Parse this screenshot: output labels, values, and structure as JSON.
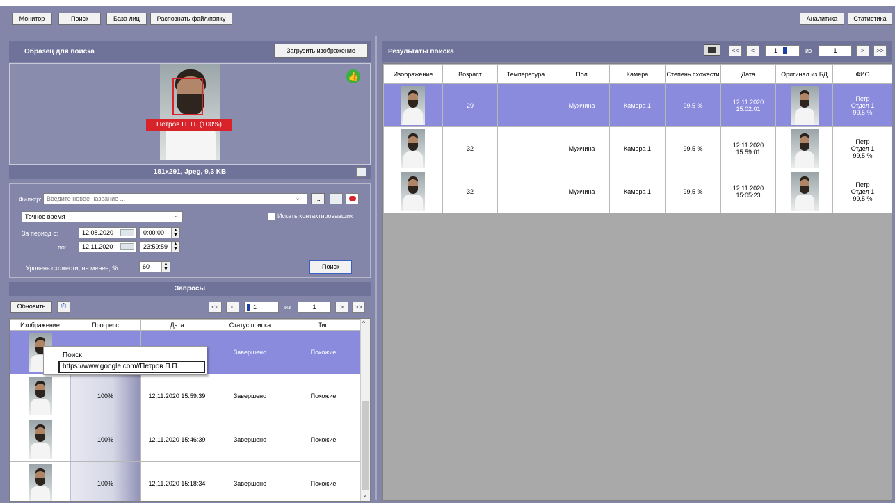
{
  "colors": {
    "panel_bg": "#8386a8",
    "header_bg": "#6f7399",
    "selected_row": "#8a8bdd",
    "results_bg": "#a9a9a9",
    "like_icon": "#3bb03b",
    "face_box": "#d9232a"
  },
  "toolbar": {
    "left": [
      "Монитор",
      "Поиск",
      "База лиц",
      "Распознать файл/папку"
    ],
    "right": [
      "Аналитика",
      "Статистика"
    ]
  },
  "sample": {
    "title": "Образец для поиска",
    "upload_label": "Загрузить изображение",
    "face_label": "Петров П. П. (100%)",
    "image_info": "181x291, Jpeg, 9,3 KB"
  },
  "filter": {
    "label": "Фильтр:",
    "placeholder": "Введите новое название ...",
    "more": "...",
    "time_mode": "Точное время",
    "contacts_label": "Искать контактировавших",
    "period_from_label": "За период с:",
    "period_to_label": "по:",
    "from_date": "12.08.2020",
    "from_time": "0:00:00",
    "to_date": "12.11.2020",
    "to_time": "23:59:59",
    "similarity_label": "Уровень схожести, не менее, %:",
    "similarity_value": "60",
    "search_button": "Поиск"
  },
  "requests": {
    "title": "Запросы",
    "refresh": "Обновить",
    "page": "1",
    "of_label": "из",
    "total": "1",
    "nav": {
      "first": "<<",
      "prev": "<",
      "next": ">",
      "last": ">>"
    },
    "columns": [
      "Изображение",
      "Прогресс",
      "Дата",
      "Статус поиска",
      "Тип"
    ],
    "rows": [
      {
        "progress": "",
        "date": "",
        "status": "Завершено",
        "type": "Похожие",
        "selected": true
      },
      {
        "progress": "100%",
        "date": "12.11.2020 15:59:39",
        "status": "Завершено",
        "type": "Похожие",
        "selected": false
      },
      {
        "progress": "100%",
        "date": "12.11.2020 15:46:39",
        "status": "Завершено",
        "type": "Похожие",
        "selected": false
      },
      {
        "progress": "100%",
        "date": "12.11.2020 15:18:34",
        "status": "Завершено",
        "type": "Похожие",
        "selected": false
      }
    ],
    "context_menu": {
      "item1": "Поиск",
      "item2": "https://www.google.com//Петров П.П."
    }
  },
  "results": {
    "title": "Результаты поиска",
    "page": "1",
    "of_label": "из",
    "total": "1",
    "nav": {
      "first": "<<",
      "prev": "<",
      "next": ">",
      "last": ">>"
    },
    "columns": [
      "Изображение",
      "Возраст",
      "Температура",
      "Пол",
      "Камера",
      "Степень схожести",
      "Дата",
      "Оригинал из БД",
      "ФИО"
    ],
    "rows": [
      {
        "age": "29",
        "temperature": "",
        "gender": "Мужчина",
        "camera": "Камера 1",
        "similarity": "99,5 %",
        "date": "12.11.2020",
        "time": "15:02:01",
        "name": "Петр",
        "dept": "Отдел 1",
        "score": "99,5 %",
        "selected": true
      },
      {
        "age": "32",
        "temperature": "",
        "gender": "Мужчина",
        "camera": "Камера 1",
        "similarity": "99,5 %",
        "date": "12.11.2020",
        "time": "15:59:01",
        "name": "Петр",
        "dept": "Отдел 1",
        "score": "99,5 %",
        "selected": false
      },
      {
        "age": "32",
        "temperature": "",
        "gender": "Мужчина",
        "camera": "Камера 1",
        "similarity": "99,5 %",
        "date": "12.11.2020",
        "time": "15:05:23",
        "name": "Петр",
        "dept": "Отдел 1",
        "score": "99,5 %",
        "selected": false
      }
    ]
  }
}
